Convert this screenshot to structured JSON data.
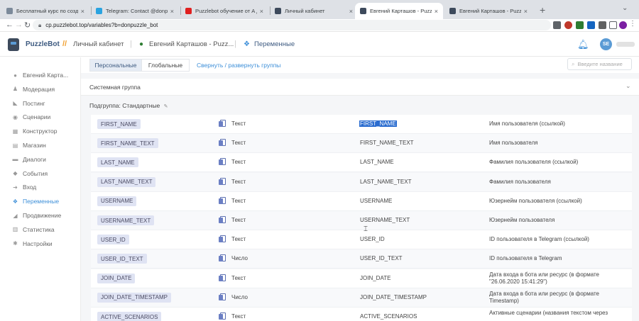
{
  "browser": {
    "tabs": [
      {
        "title": "Бесплатный курс по создани",
        "favicon_color": "#7c8a9a",
        "active": false
      },
      {
        "title": "Telegram: Contact @donpuzzle",
        "favicon_color": "#2aa3e0",
        "active": false
      },
      {
        "title": "Puzzlebot обучение от А до Я",
        "favicon_color": "#e02020",
        "active": false
      },
      {
        "title": "Личный кабинет",
        "favicon_color": "#3d4a5c",
        "active": false
      },
      {
        "title": "Евгений Карташов - Puzzlebot",
        "favicon_color": "#3d4a5c",
        "active": true
      },
      {
        "title": "Евгений Карташов - Puzzlebot",
        "favicon_color": "#3d4a5c",
        "active": false
      }
    ],
    "new_tab_icon": "+",
    "url": "cp.puzzlebot.top/variables?b=donpuzzle_bot",
    "nav": {
      "back": "←",
      "forward": "→",
      "reload": "↻"
    }
  },
  "header": {
    "brand": "PuzzleBot",
    "sep": "//",
    "crumbs": [
      "Личный кабинет",
      "Евгений Карташов - Puzz...",
      "Переменные"
    ],
    "avatar_initials": "SE"
  },
  "sidebar": {
    "items": [
      {
        "label": "Евгений Карта...",
        "icon": "bot-icon",
        "glyph": "●",
        "active": false
      },
      {
        "label": "Модерация",
        "icon": "users-icon",
        "glyph": "♟",
        "active": false
      },
      {
        "label": "Постинг",
        "icon": "megaphone-icon",
        "glyph": "◣",
        "active": false
      },
      {
        "label": "Сценарии",
        "icon": "scenario-icon",
        "glyph": "◉",
        "active": false
      },
      {
        "label": "Конструктор",
        "icon": "constructor-icon",
        "glyph": "▦",
        "active": false
      },
      {
        "label": "Магазин",
        "icon": "shop-icon",
        "glyph": "▤",
        "active": false
      },
      {
        "label": "Диалоги",
        "icon": "dialogs-icon",
        "glyph": "▬",
        "active": false
      },
      {
        "label": "События",
        "icon": "events-icon",
        "glyph": "◆",
        "active": false
      },
      {
        "label": "Вход",
        "icon": "login-icon",
        "glyph": "➜",
        "active": false
      },
      {
        "label": "Переменные",
        "icon": "variables-icon",
        "glyph": "❖",
        "active": true
      },
      {
        "label": "Продвижение",
        "icon": "promotion-icon",
        "glyph": "◢",
        "active": false
      },
      {
        "label": "Статистика",
        "icon": "stats-icon",
        "glyph": "▥",
        "active": false
      },
      {
        "label": "Настройки",
        "icon": "settings-icon",
        "glyph": "✱",
        "active": false
      }
    ]
  },
  "main": {
    "tabs": [
      {
        "label": "Персональные",
        "active": true
      },
      {
        "label": "Глобальные",
        "active": false
      }
    ],
    "toggle_groups": "Свернуть / развернуть группы",
    "search_placeholder": "Введите название",
    "group_title": "Системная группа",
    "subgroup_label": "Подгруппа:",
    "subgroup_name": "Стандартные",
    "rows": [
      {
        "tag": "FIRST_NAME",
        "type": "Текст",
        "code": "FIRST_NAME",
        "desc": "Имя пользователя (ссылкой)",
        "selected": true
      },
      {
        "tag": "FIRST_NAME_TEXT",
        "type": "Текст",
        "code": "FIRST_NAME_TEXT",
        "desc": "Имя пользователя"
      },
      {
        "tag": "LAST_NAME",
        "type": "Текст",
        "code": "LAST_NAME",
        "desc": "Фамилия пользователя (ссылкой)"
      },
      {
        "tag": "LAST_NAME_TEXT",
        "type": "Текст",
        "code": "LAST_NAME_TEXT",
        "desc": "Фамилия пользователя"
      },
      {
        "tag": "USERNAME",
        "type": "Текст",
        "code": "USERNAME",
        "desc": "Юзернейм пользователя (ссылкой)"
      },
      {
        "tag": "USERNAME_TEXT",
        "type": "Текст",
        "code": "USERNAME_TEXT",
        "desc": "Юзернейм пользователя"
      },
      {
        "tag": "USER_ID",
        "type": "Текст",
        "code": "USER_ID",
        "desc": "ID пользователя в Telegram (ссылкой)"
      },
      {
        "tag": "USER_ID_TEXT",
        "type": "Число",
        "code": "USER_ID_TEXT",
        "desc": "ID пользователя в Telegram"
      },
      {
        "tag": "JOIN_DATE",
        "type": "Текст",
        "code": "JOIN_DATE",
        "desc": "Дата входа в бота или ресурс (в формате \"26.06.2020 15:41:29\")",
        "two": true
      },
      {
        "tag": "JOIN_DATE_TIMESTAMP",
        "type": "Число",
        "code": "JOIN_DATE_TIMESTAMP",
        "desc": "Дата входа в бота или ресурс (в формате Timestamp)",
        "two": true
      },
      {
        "tag": "ACTIVE_SCENARIOS",
        "type": "Текст",
        "code": "ACTIVE_SCENARIOS",
        "desc": "Активные сценарии (названия текстом через",
        "two": true
      }
    ]
  }
}
